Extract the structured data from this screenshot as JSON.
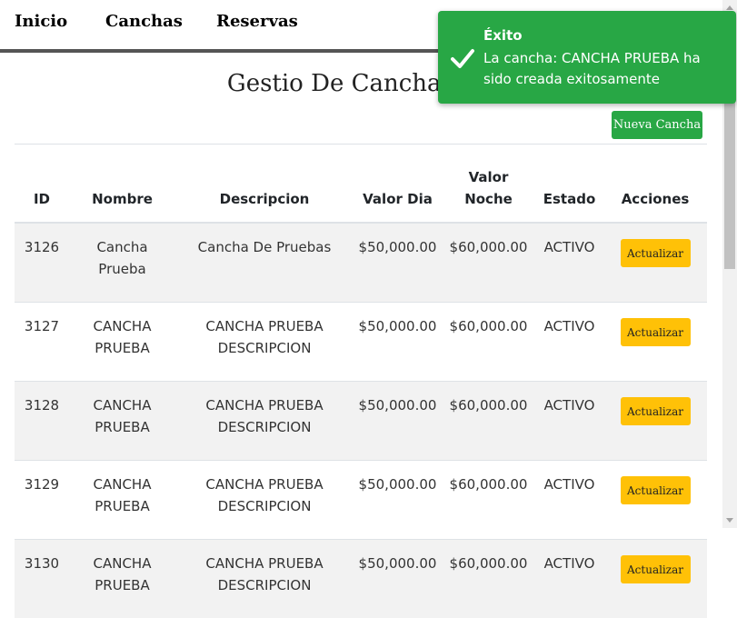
{
  "nav": {
    "items": [
      "Inicio",
      "Canchas",
      "Reservas"
    ]
  },
  "page": {
    "title": "Gestio De Canchas - D"
  },
  "actions": {
    "new_label": "Nueva Cancha"
  },
  "table": {
    "headers": [
      "ID",
      "Nombre",
      "Descripcion",
      "Valor Dia",
      "Valor Noche",
      "Estado",
      "Acciones"
    ],
    "action_label": "Actualizar",
    "rows": [
      {
        "id": "3126",
        "nombre": "Cancha Prueba",
        "descripcion": "Cancha De Pruebas",
        "valor_dia": "$50,000.00",
        "valor_noche": "$60,000.00",
        "estado": "ACTIVO"
      },
      {
        "id": "3127",
        "nombre": "CANCHA PRUEBA",
        "descripcion": "CANCHA PRUEBA DESCRIPCION",
        "valor_dia": "$50,000.00",
        "valor_noche": "$60,000.00",
        "estado": "ACTIVO"
      },
      {
        "id": "3128",
        "nombre": "CANCHA PRUEBA",
        "descripcion": "CANCHA PRUEBA DESCRIPCION",
        "valor_dia": "$50,000.00",
        "valor_noche": "$60,000.00",
        "estado": "ACTIVO"
      },
      {
        "id": "3129",
        "nombre": "CANCHA PRUEBA",
        "descripcion": "CANCHA PRUEBA DESCRIPCION",
        "valor_dia": "$50,000.00",
        "valor_noche": "$60,000.00",
        "estado": "ACTIVO"
      },
      {
        "id": "3130",
        "nombre": "CANCHA PRUEBA",
        "descripcion": "CANCHA PRUEBA DESCRIPCION",
        "valor_dia": "$50,000.00",
        "valor_noche": "$60,000.00",
        "estado": "ACTIVO"
      }
    ]
  },
  "toast": {
    "title": "Éxito",
    "message": "La cancha: CANCHA PRUEBA ha sido creada exitosamente",
    "icon": "check-icon",
    "color": "#28a745"
  },
  "colors": {
    "success": "#28a745",
    "warning": "#ffc107",
    "stripe": "#f2f2f2",
    "nav_border": "#555555"
  }
}
